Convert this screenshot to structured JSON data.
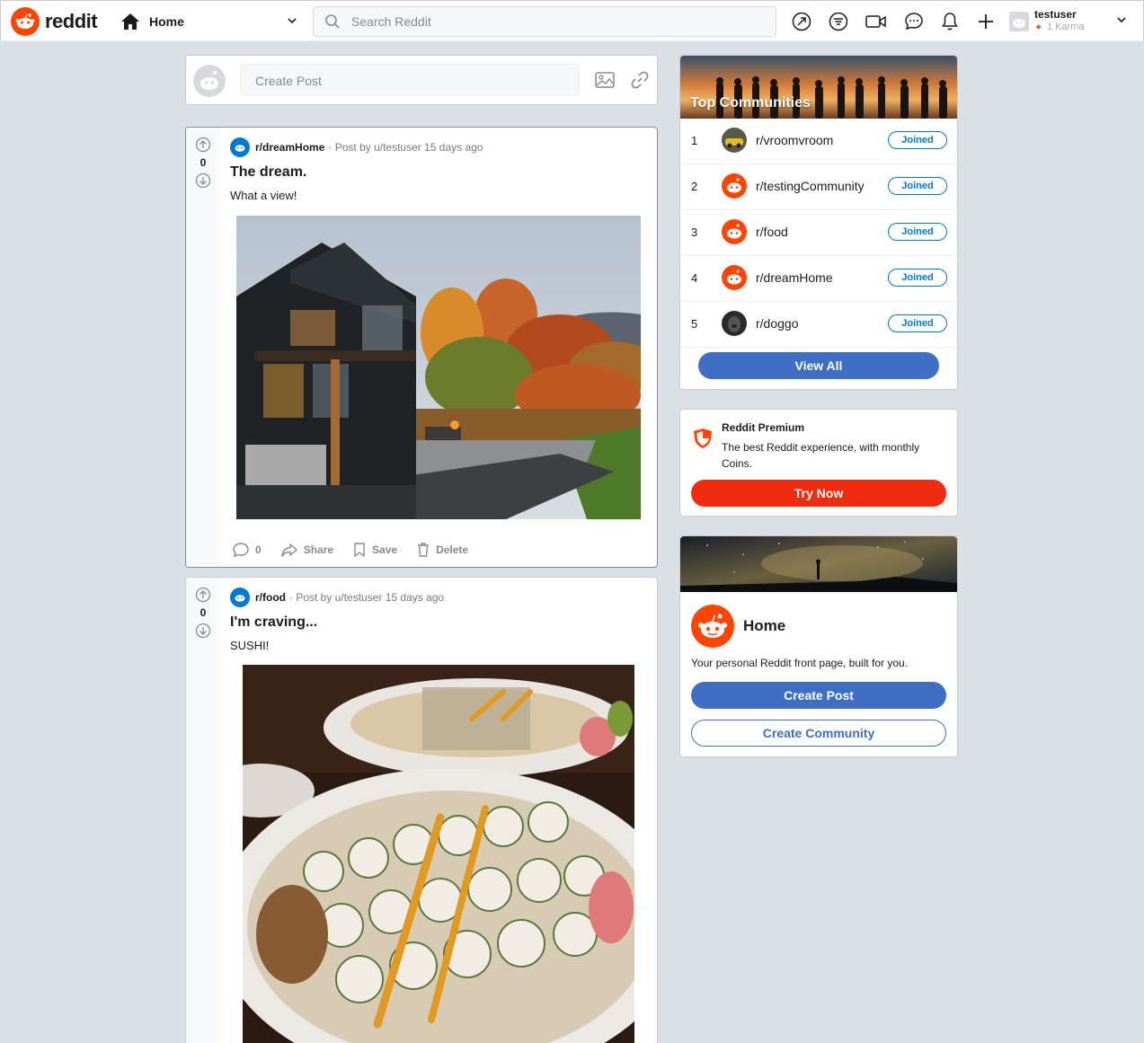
{
  "header": {
    "logo_text": "reddit",
    "home_label": "Home",
    "search_placeholder": "Search Reddit",
    "username": "testuser",
    "karma": "1 Karma"
  },
  "create_post": {
    "placeholder": "Create Post"
  },
  "posts": [
    {
      "subreddit": "r/dreamHome",
      "byline": "· Post by u/testuser 15 days ago",
      "votes": "0",
      "title": "The dream.",
      "body": "What a view!",
      "comments": "0",
      "share": "Share",
      "save": "Save",
      "delete": "Delete"
    },
    {
      "subreddit": "r/food",
      "byline": "· Post by u/testuser 15 days ago",
      "votes": "0",
      "title": "I'm craving...",
      "body": "SUSHI!"
    }
  ],
  "top_communities": {
    "title": "Top Communities",
    "items": [
      {
        "rank": "1",
        "name": "r/vroomvroom",
        "status": "Joined"
      },
      {
        "rank": "2",
        "name": "r/testingCommunity",
        "status": "Joined"
      },
      {
        "rank": "3",
        "name": "r/food",
        "status": "Joined"
      },
      {
        "rank": "4",
        "name": "r/dreamHome",
        "status": "Joined"
      },
      {
        "rank": "5",
        "name": "r/doggo",
        "status": "Joined"
      }
    ],
    "view_all": "View All"
  },
  "premium": {
    "title": "Reddit Premium",
    "desc": "The best Reddit experience, with monthly Coins.",
    "button": "Try Now"
  },
  "home_card": {
    "title": "Home",
    "desc": "Your personal Reddit front page, built for you.",
    "create_post": "Create Post",
    "create_community": "Create Community"
  },
  "colors": {
    "brand": "#ff4500",
    "accent": "#3f6fc4",
    "premium": "#f02c0e"
  }
}
